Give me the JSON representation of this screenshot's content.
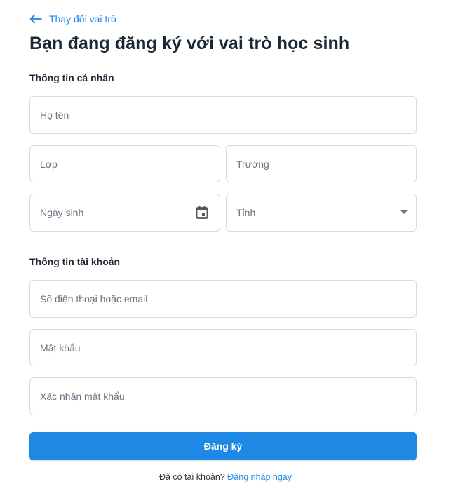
{
  "back_link": {
    "label": "Thay đổi vai trò",
    "icon": "arrow-left-icon"
  },
  "page_title": "Bạn đang đăng ký với vai trò học sinh",
  "personal_section": {
    "heading": "Thông tin cá nhân",
    "full_name_placeholder": "Họ tên",
    "class_placeholder": "Lớp",
    "school_placeholder": "Trường",
    "birthdate_placeholder": "Ngày sinh",
    "province_placeholder": "Tỉnh"
  },
  "account_section": {
    "heading": "Thông tin tài khoản",
    "phone_email_placeholder": "Số điện thoại hoặc email",
    "password_placeholder": "Mật khẩu",
    "confirm_password_placeholder": "Xác nhận mật khẩu"
  },
  "submit_label": "Đăng ký",
  "footer": {
    "text": "Đã có tài khoản?",
    "login_link": "Đăng nhập ngay"
  },
  "colors": {
    "accent": "#1e88e5",
    "border": "#d7dbe0",
    "title": "#1b2733"
  }
}
